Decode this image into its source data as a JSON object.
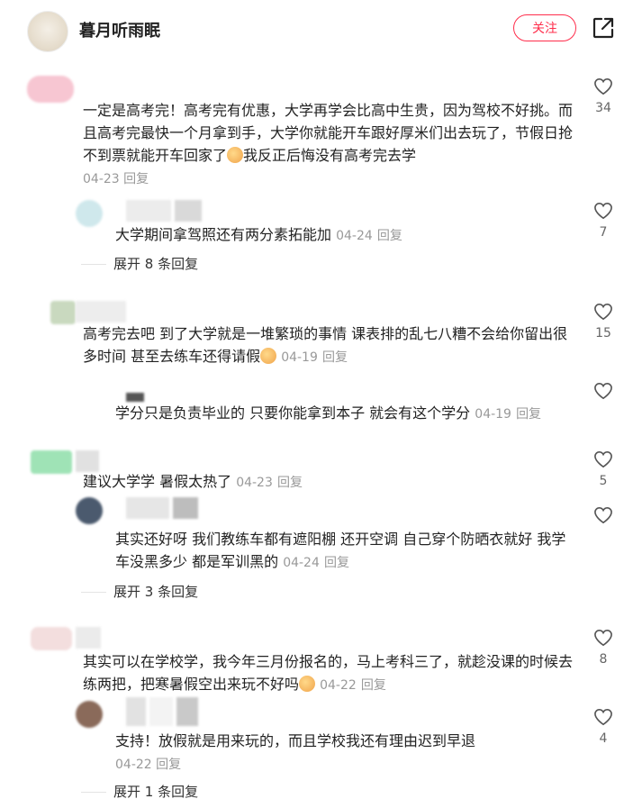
{
  "header": {
    "author": "暮月听雨眠",
    "follow_label": "关注"
  },
  "comments": [
    {
      "text": "一定是高考完！高考完有优惠，大学再学会比高中生贵，因为驾校不好挑。而且高考完最快一个月拿到手，大学你就能开车跟好厚米们出去玩了，节假日抢不到票就能开车回家了",
      "text_tail": "我反正后悔没有高考完去学",
      "date": "04-23",
      "reply": "回复",
      "likes": "34"
    },
    {
      "text": "大学期间拿驾照还有两分素拓能加",
      "date": "04-24",
      "reply": "回复",
      "likes": "7",
      "expand": "展开 8 条回复"
    },
    {
      "text": "高考完去吧 到了大学就是一堆繁琐的事情 课表排的乱七八糟不会给你留出很多时间 甚至去练车还得请假",
      "date": "04-19",
      "reply": "回复",
      "likes": "15"
    },
    {
      "text": "学分只是负责毕业的 只要你能拿到本子 就会有这个学分",
      "date": "04-19",
      "reply": "回复"
    },
    {
      "text": "建议大学学 暑假太热了",
      "date": "04-23",
      "reply": "回复",
      "likes": "5"
    },
    {
      "text": "其实还好呀 我们教练车都有遮阳棚 还开空调 自己穿个防晒衣就好 我学车没黑多少 都是军训黑的",
      "date": "04-24",
      "reply": "回复",
      "expand": "展开 3 条回复"
    },
    {
      "text": "其实可以在学校学，我今年三月份报名的，马上考科三了，就趁没课的时候去练两把，把寒暑假空出来玩不好吗",
      "date": "04-22",
      "reply": "回复",
      "likes": "8"
    },
    {
      "text": "支持！放假就是用来玩的，而且学校我还有理由迟到早退",
      "date": "04-22",
      "reply": "回复",
      "likes": "4",
      "expand": "展开 1 条回复"
    }
  ],
  "colors": {
    "accent": "#ff2d4b",
    "meta": "#999999"
  }
}
